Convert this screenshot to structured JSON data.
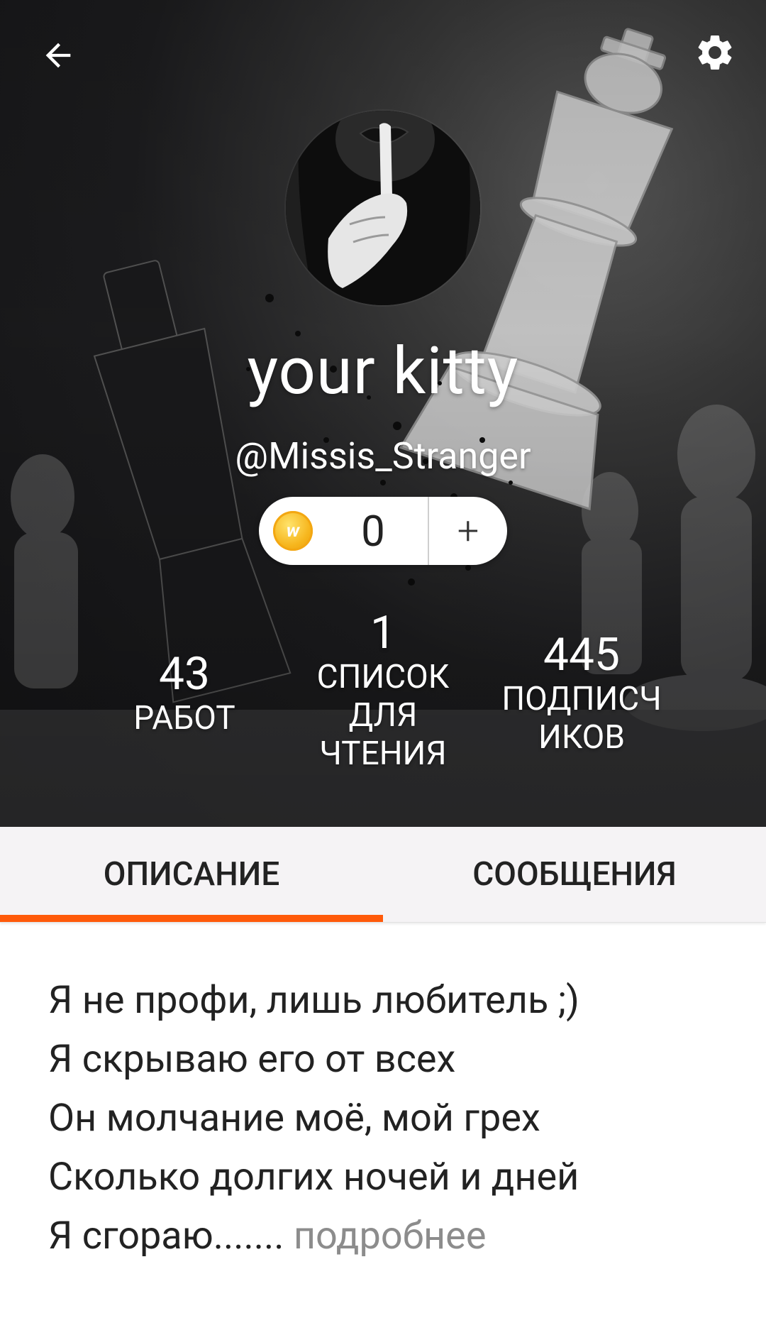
{
  "header": {
    "back_icon": "arrow-left-icon",
    "settings_icon": "gear-icon"
  },
  "profile": {
    "display_name": "your kitty",
    "username": "@Missis_Stranger",
    "coins": "0",
    "add_label": "+"
  },
  "stats": {
    "works": {
      "value": "43",
      "label": "РАБОТ"
    },
    "reading_lists": {
      "value": "1",
      "label_lines": [
        "СПИСОК",
        "ДЛЯ",
        "ЧТЕНИЯ"
      ]
    },
    "followers": {
      "value": "445",
      "label_lines": [
        "ПОДПИСЧ",
        "ИКОВ"
      ]
    }
  },
  "tabs": [
    {
      "label": "ОПИСАНИЕ",
      "active": true
    },
    {
      "label": "СООБЩЕНИЯ",
      "active": false
    }
  ],
  "description": {
    "lines": [
      "Я не профи, лишь любитель ;)",
      "Я скрываю его от всех",
      "Он молчание моё, мой грех",
      "Сколько долгих ночей и дней",
      "Я сгораю......."
    ],
    "more_link": "подробнее"
  },
  "colors": {
    "accent": "#ff5a0a",
    "coin": "#f6b51c"
  }
}
